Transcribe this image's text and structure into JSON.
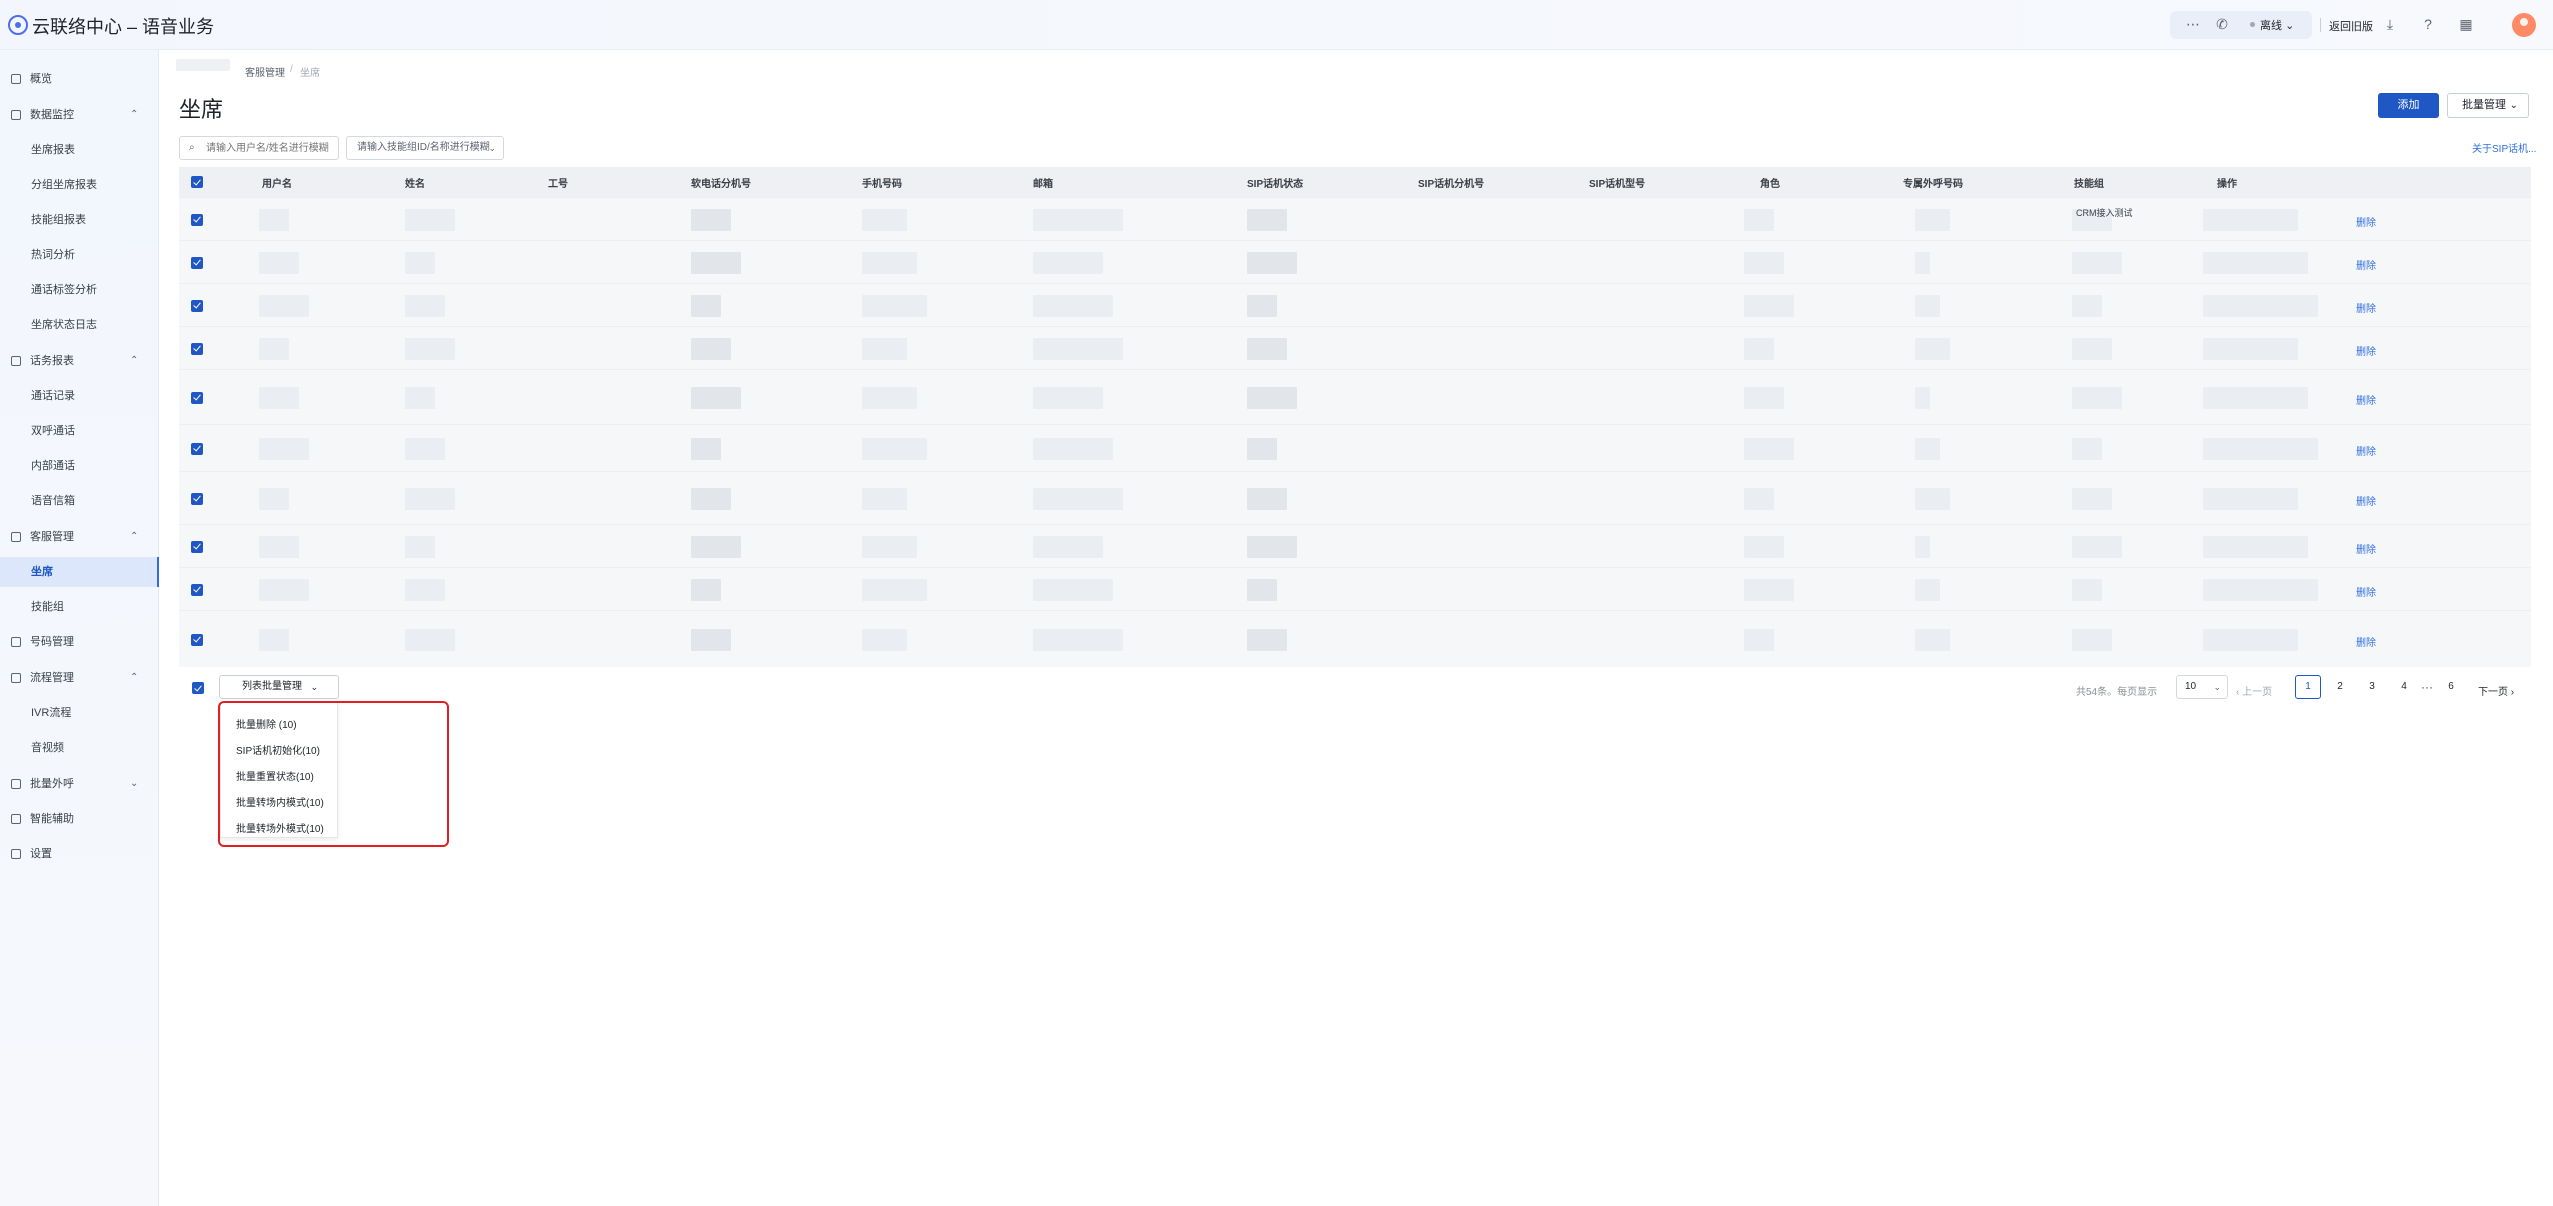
{
  "header": {
    "app_title": "云联络中心 – 语音业务",
    "status": "离线",
    "return_old": "返回旧版",
    "icons": [
      "chat-icon",
      "phone-icon",
      "download-icon",
      "help-icon",
      "apps-icon"
    ]
  },
  "sidebar": {
    "items": [
      {
        "label": "概览",
        "type": "top"
      },
      {
        "label": "数据监控",
        "type": "group",
        "expanded": true
      },
      {
        "label": "坐席报表",
        "type": "sub"
      },
      {
        "label": "分组坐席报表",
        "type": "sub"
      },
      {
        "label": "技能组报表",
        "type": "sub"
      },
      {
        "label": "热词分析",
        "type": "sub"
      },
      {
        "label": "通话标签分析",
        "type": "sub"
      },
      {
        "label": "坐席状态日志",
        "type": "sub"
      },
      {
        "label": "话务报表",
        "type": "group",
        "expanded": true
      },
      {
        "label": "通话记录",
        "type": "sub"
      },
      {
        "label": "双呼通话",
        "type": "sub"
      },
      {
        "label": "内部通话",
        "type": "sub"
      },
      {
        "label": "语音信箱",
        "type": "sub"
      },
      {
        "label": "客服管理",
        "type": "group",
        "expanded": true
      },
      {
        "label": "坐席",
        "type": "sub",
        "active": true
      },
      {
        "label": "技能组",
        "type": "sub"
      },
      {
        "label": "号码管理",
        "type": "top"
      },
      {
        "label": "流程管理",
        "type": "group",
        "expanded": true
      },
      {
        "label": "IVR流程",
        "type": "sub"
      },
      {
        "label": "音视频",
        "type": "sub"
      },
      {
        "label": "批量外呼",
        "type": "group",
        "expanded": false
      },
      {
        "label": "智能辅助",
        "type": "top"
      },
      {
        "label": "设置",
        "type": "top"
      }
    ]
  },
  "breadcrumb": {
    "parent": "客服管理",
    "current": "坐席"
  },
  "page": {
    "title": "坐席",
    "add_button": "添加",
    "batch_button": "批量管理",
    "search_placeholder": "请输入用户名/姓名进行模糊",
    "skill_select_placeholder": "请输入技能组ID/名称进行模糊",
    "sip_link": "关于SIP话机..."
  },
  "table": {
    "columns": [
      "用户名",
      "姓名",
      "工号",
      "软电话分机号",
      "手机号码",
      "邮箱",
      "SIP话机状态",
      "SIP话机分机号",
      "SIP话机型号",
      "角色",
      "专属外呼号码",
      "技能组",
      "操作"
    ],
    "first_row_skill_text": "CRM接入测试",
    "rows": [
      {
        "action": "删除"
      },
      {
        "action": "删除"
      },
      {
        "action": "删除"
      },
      {
        "action": "删除"
      },
      {
        "action": "删除"
      },
      {
        "action": "删除"
      },
      {
        "action": "删除"
      },
      {
        "action": "删除"
      },
      {
        "action": "删除"
      },
      {
        "action": "删除"
      }
    ]
  },
  "footer": {
    "list_batch_button": "列表批量管理",
    "dropdown_options": [
      "批量删除 (10)",
      "SIP话机初始化(10)",
      "批量重置状态(10)",
      "批量转场内模式(10)",
      "批量转场外模式(10)"
    ],
    "total_text": "共54条。每页显示",
    "page_size": "10",
    "prev": "上一页",
    "pages": [
      "1",
      "2",
      "3",
      "4",
      "6"
    ],
    "current_page": "1",
    "next": "下一页",
    "highlight_color": "#e02020"
  },
  "colors": {
    "accent": "#1f57c4",
    "link": "#2f6fe0"
  }
}
